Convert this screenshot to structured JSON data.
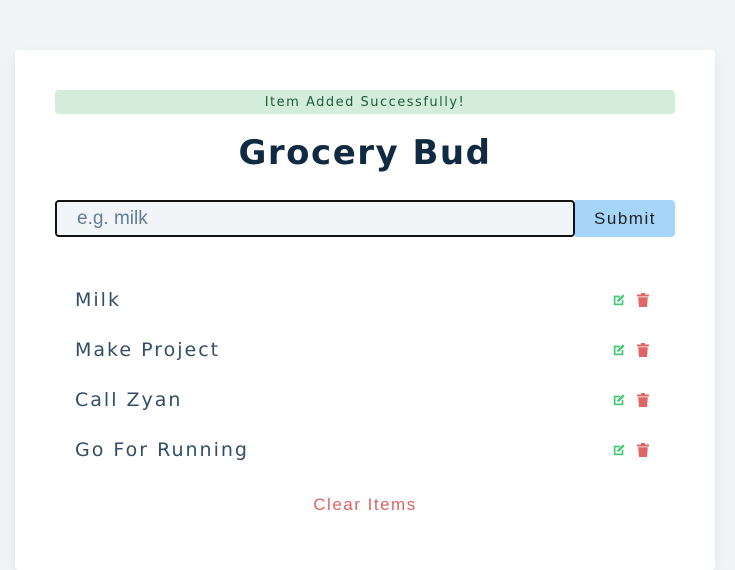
{
  "alert": {
    "text": "Item Added Successfully!"
  },
  "title": "Grocery Bud",
  "form": {
    "placeholder": "e.g. milk",
    "submit_label": "Submit"
  },
  "items": [
    {
      "title": "Milk"
    },
    {
      "title": "Make Project"
    },
    {
      "title": "Call Zyan"
    },
    {
      "title": "Go For Running"
    }
  ],
  "clear_label": "Clear Items",
  "icons": {
    "edit": "edit-icon",
    "delete": "trash-icon"
  },
  "colors": {
    "edit": "#4bc77a",
    "delete": "#e06565",
    "title": "#102a42",
    "submit_bg": "#a5d5f8",
    "alert_bg": "#d4eddb"
  }
}
